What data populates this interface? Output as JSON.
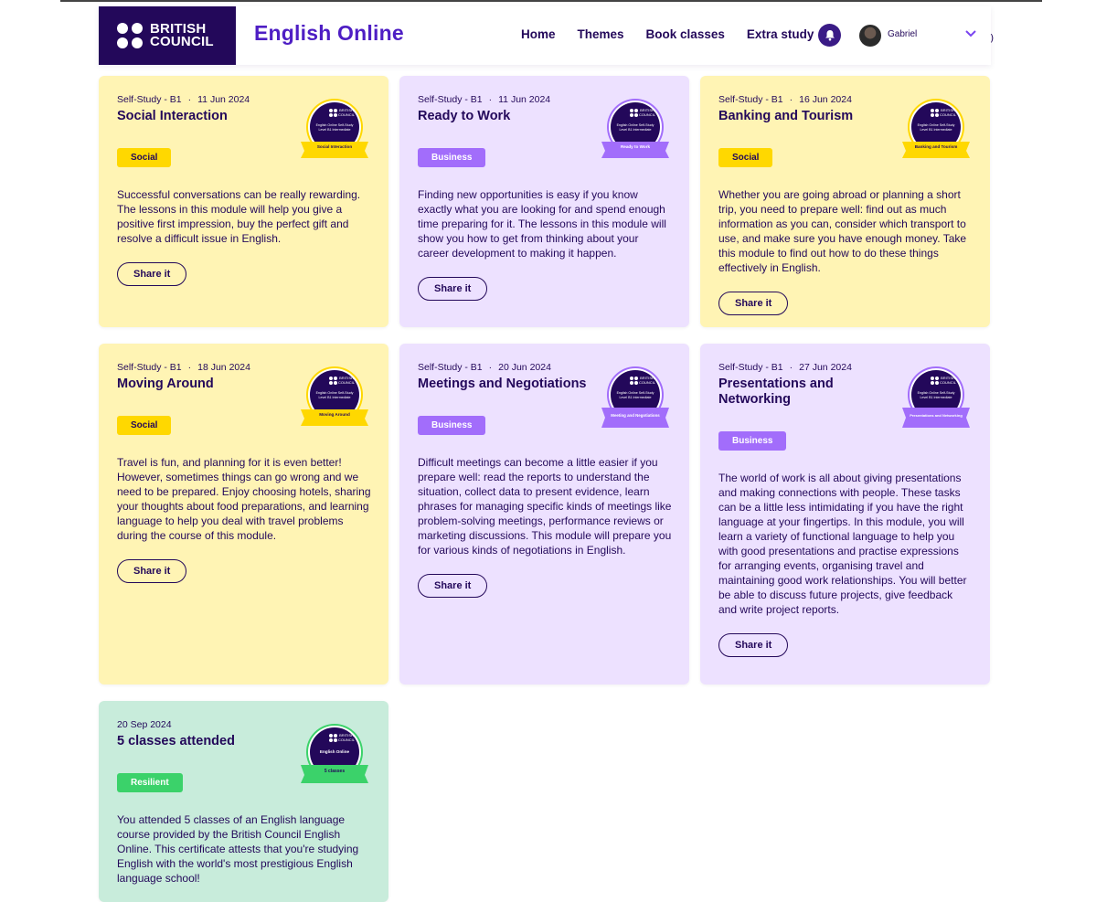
{
  "header": {
    "logo_line1": "BRITISH",
    "logo_line2": "COUNCIL",
    "app_title": "English Online",
    "nav": [
      "Home",
      "Themes",
      "Book classes",
      "Extra study"
    ],
    "user_name": "Gabriel"
  },
  "cards": [
    {
      "meta": "Self-Study - B1",
      "date": "11 Jun 2024",
      "title": "Social Interaction",
      "tag": "Social",
      "badge_line1": "English Online Self-Study",
      "badge_line2": "Level B1 Intermediate",
      "badge_ribbon": "Social Interaction",
      "description": "Successful conversations can be really rewarding. The lessons in this module will help you give a positive first impression, buy the perfect gift and resolve a difficult issue in English.",
      "share": "Share it"
    },
    {
      "meta": "Self-Study - B1",
      "date": "11 Jun 2024",
      "title": "Ready to Work",
      "tag": "Business",
      "badge_line1": "English Online Self-Study",
      "badge_line2": "Level B1 Intermediate",
      "badge_ribbon": "Ready to Work",
      "description": "Finding new opportunities is easy if you know exactly what you are looking for and spend enough time preparing for it. The lessons in this module will show you how to get from thinking about your career development to making it happen.",
      "share": "Share it"
    },
    {
      "meta": "Self-Study - B1",
      "date": "16 Jun 2024",
      "title": "Banking and Tourism",
      "tag": "Social",
      "badge_line1": "English Online Self-Study",
      "badge_line2": "Level B1 Intermediate",
      "badge_ribbon": "Banking and Tourism",
      "description": "Whether you are going abroad or planning a short trip, you need to prepare well: find out as much information as you can, consider which transport to use, and make sure you have enough money. Take this module to find out how to do these things effectively in English.",
      "share": "Share it"
    },
    {
      "meta": "Self-Study - B1",
      "date": "18 Jun 2024",
      "title": "Moving Around",
      "tag": "Social",
      "badge_line1": "English Online Self-Study",
      "badge_line2": "Level B1 Intermediate",
      "badge_ribbon": "Moving Around",
      "description": "Travel is fun, and planning for it is even better! However, sometimes things can go wrong and we need to be prepared. Enjoy choosing hotels, sharing your thoughts about food preparations, and learning language to help you deal with travel problems during the course of this module.",
      "share": "Share it"
    },
    {
      "meta": "Self-Study - B1",
      "date": "20 Jun 2024",
      "title": "Meetings and Negotiations",
      "tag": "Business",
      "badge_line1": "English Online Self-Study",
      "badge_line2": "Level B1 Intermediate",
      "badge_ribbon": "Meeting and Negotiations",
      "description": "Difficult meetings can become a little easier if you prepare well: read the reports to understand the situation, collect data to present evidence, learn phrases for managing specific kinds of meetings like problem-solving meetings, performance reviews or marketing discussions. This module will prepare you for various kinds of negotiations in English.",
      "share": "Share it"
    },
    {
      "meta": "Self-Study - B1",
      "date": "27 Jun 2024",
      "title": "Presentations and Networking",
      "tag": "Business",
      "badge_line1": "English Online Self-Study",
      "badge_line2": "Level B1 Intermediate",
      "badge_ribbon": "Presentations and Networking",
      "description": "The world of work is all about giving presentations and making connections with people. These tasks can be a little less intimidating if you have the right language at your fingertips. In this module, you will learn a variety of functional language to help you with good presentations and practise expressions for arranging events, organising travel and maintaining good work relationships. You will better be able to discuss future projects, give feedback and write project reports.",
      "share": "Share it"
    },
    {
      "meta": "",
      "date": "20 Sep 2024",
      "title": "5 classes attended",
      "tag": "Resilient",
      "badge_line1": "English Online",
      "badge_line2": "",
      "badge_ribbon": "5 classes",
      "description": "You attended 5 classes of an English language course provided by the British Council English Online. This certificate attests that you're studying English with the world's most prestigious English language school!",
      "share": "Share it"
    }
  ],
  "colors": {
    "brand_dark": "#23085a",
    "brand_purple": "#4e1ec4",
    "social_tag": "#ffd800",
    "business_tag": "#a26dfb",
    "resilient_tag": "#3bd26a",
    "card_yellow": "#fff4b4",
    "card_purple": "#ede1ff",
    "card_green": "#c8ecdb"
  },
  "icons": [
    "british-council-logo-icon",
    "bell-icon",
    "chevron-down-icon",
    "achievement-badge-icon"
  ]
}
